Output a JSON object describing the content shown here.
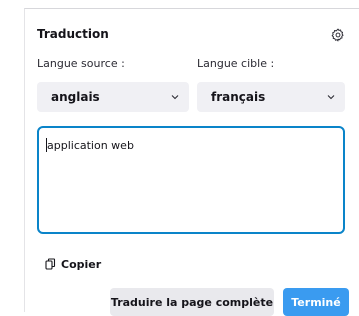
{
  "panel": {
    "title": "Traduction",
    "settings_icon": "gear-icon"
  },
  "source": {
    "label": "Langue source :",
    "value": "anglais"
  },
  "target": {
    "label": "Langue cible :",
    "value": "français"
  },
  "input": {
    "text": "application web"
  },
  "copy": {
    "label": "Copier",
    "icon": "copy-icon"
  },
  "buttons": {
    "translate_full": "Traduire la page complète",
    "done": "Terminé"
  },
  "colors": {
    "accent": "#0a84c9",
    "done_button": "#3a9bf0",
    "select_bg": "#f0f0f4"
  }
}
